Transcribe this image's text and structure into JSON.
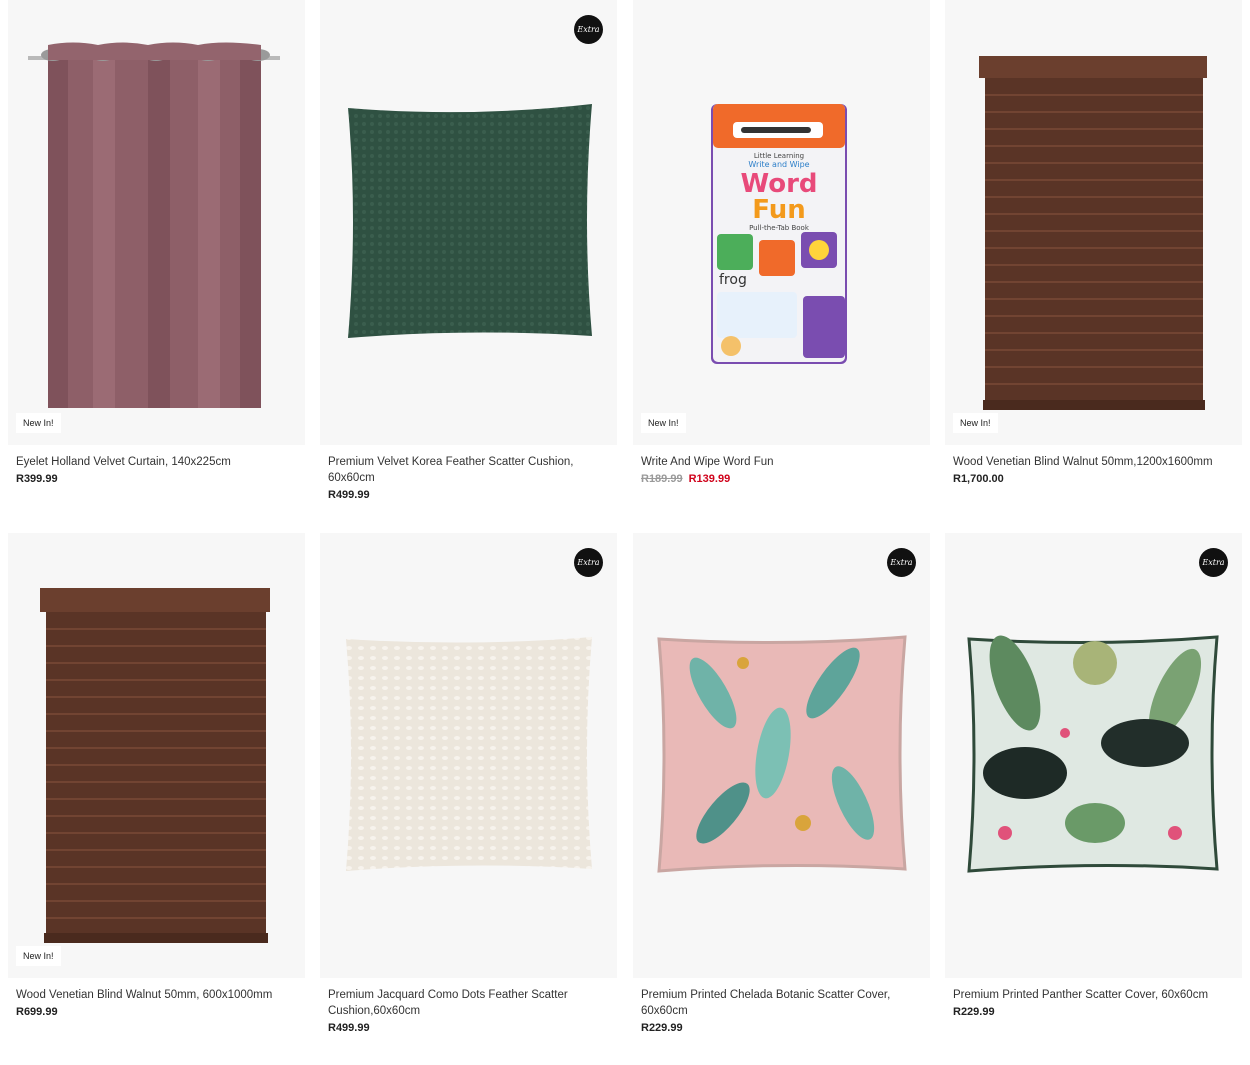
{
  "products": [
    {
      "title": "Eyelet Holland Velvet Curtain, 140x225cm",
      "price": "R399.99",
      "badge": "New In!",
      "extra": ""
    },
    {
      "title": "Premium Velvet Korea Feather Scatter Cushion, 60x60cm",
      "price": "R499.99",
      "badge": "",
      "extra": "Extra"
    },
    {
      "title": "Write And Wipe Word Fun",
      "old_price": "R189.99",
      "price": "R139.99",
      "badge": "New In!",
      "extra": "",
      "book": {
        "series": "Little Learning",
        "line1": "Write and Wipe",
        "word1": "Word",
        "word2": "Fun",
        "sub": "Pull-the-Tab Book",
        "frog": "frog"
      }
    },
    {
      "title": "Wood Venetian Blind Walnut 50mm,1200x1600mm",
      "price": "R1,700.00",
      "badge": "New In!",
      "extra": ""
    },
    {
      "title": "Wood Venetian Blind Walnut 50mm, 600x1000mm",
      "price": "R699.99",
      "badge": "New In!",
      "extra": ""
    },
    {
      "title": "Premium Jacquard Como Dots Feather Scatter Cushion,60x60cm",
      "price": "R499.99",
      "badge": "",
      "extra": "Extra"
    },
    {
      "title": "Premium Printed Chelada Botanic Scatter Cover, 60x60cm",
      "price": "R229.99",
      "badge": "",
      "extra": "Extra"
    },
    {
      "title": "Premium Printed Panther Scatter Cover, 60x60cm",
      "price": "R229.99",
      "badge": "",
      "extra": "Extra"
    }
  ],
  "colors": {
    "sale_price": "#d0021b",
    "curtain": "#8e5f68",
    "green_cushion": "#2f5142",
    "blind": "#5a3426",
    "cream_cushion": "#ece6dc",
    "pink_cushion": "#e9b9b7"
  },
  "icons": [
    "extra-badge-icon"
  ]
}
